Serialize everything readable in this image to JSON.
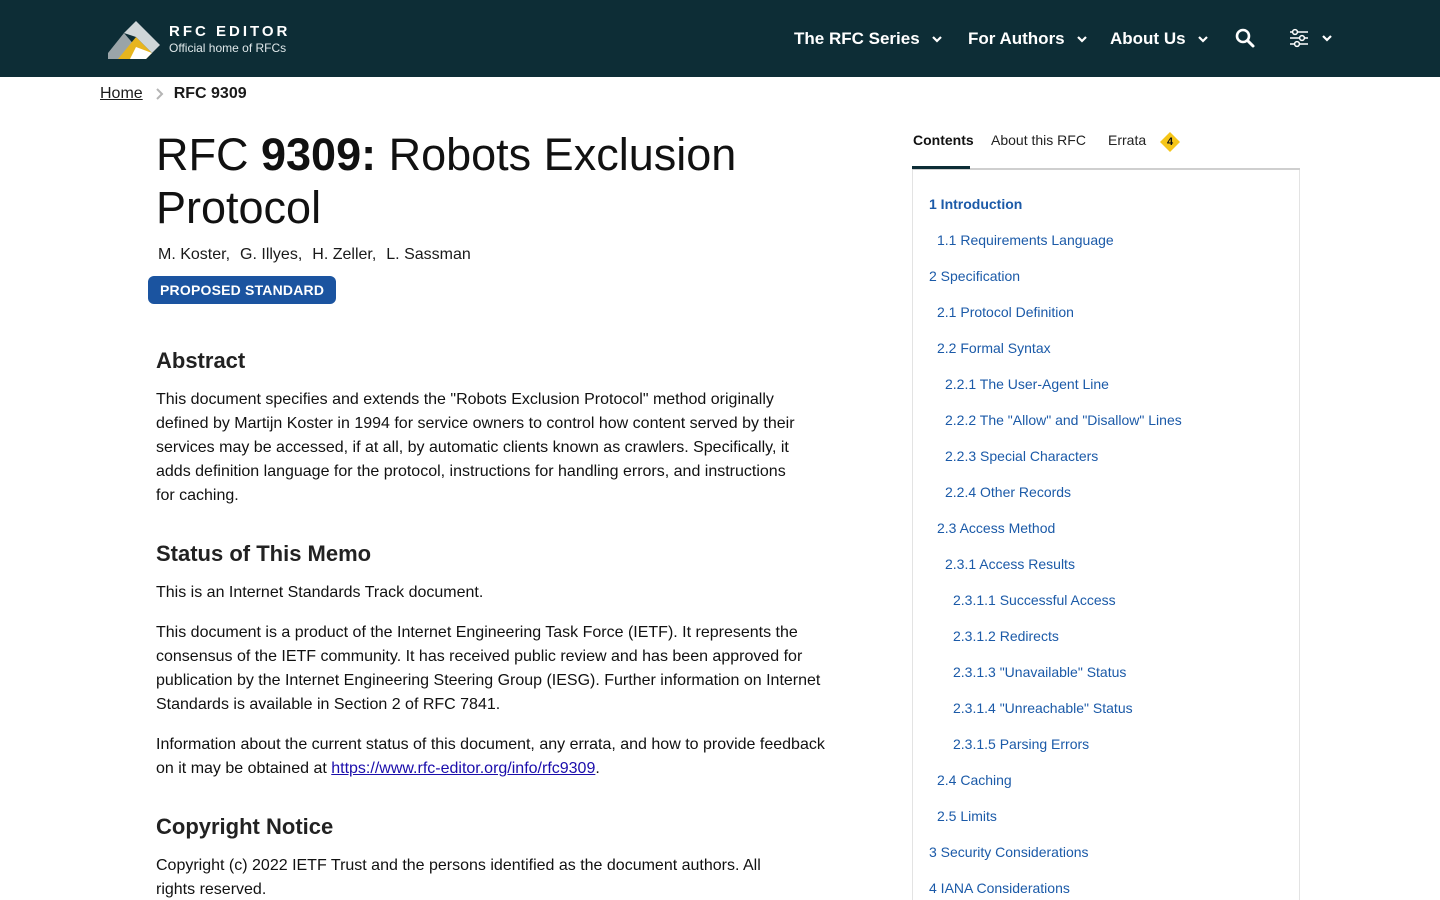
{
  "header": {
    "logo_title": "RFC EDITOR",
    "logo_subtitle": "Official home of RFCs",
    "nav": {
      "series": "The RFC Series",
      "authors": "For Authors",
      "about": "About Us"
    }
  },
  "breadcrumb": {
    "home": "Home",
    "current": "RFC 9309"
  },
  "document": {
    "title_prefix": "RFC ",
    "title_number": "9309:",
    "title_text": " Robots Exclusion Protocol",
    "authors": [
      "M. Koster,",
      "G. Illyes,",
      "H. Zeller,",
      "L. Sassman"
    ],
    "status_badge": "PROPOSED STANDARD",
    "abstract_heading": "Abstract",
    "abstract_text": "This document specifies and extends the \"Robots Exclusion Protocol\" method originally defined by Martijn Koster in 1994 for service owners to control how content served by their services may be accessed, if at all, by automatic clients known as crawlers. Specifically, it adds definition language for the protocol, instructions for handling errors, and instructions for caching.",
    "status_heading": "Status of This Memo",
    "status_p1": "This is an Internet Standards Track document.",
    "status_p2": "This document is a product of the Internet Engineering Task Force (IETF). It represents the consensus of the IETF community. It has received public review and has been approved for publication by the Internet Engineering Steering Group (IESG). Further information on Internet Standards is available in Section 2 of RFC 7841.",
    "status_p3_before": "Information about the current status of this document, any errata, and how to provide feedback on it may be obtained at ",
    "status_p3_link": "https://www.rfc-editor.org/info/rfc9309",
    "status_p3_after": ".",
    "copyright_heading": "Copyright Notice",
    "copyright_text": "Copyright (c) 2022 IETF Trust and the persons identified as the document authors. All rights reserved."
  },
  "sidebar": {
    "tabs": {
      "contents": "Contents",
      "about": "About this RFC",
      "errata": "Errata",
      "errata_count": "4"
    },
    "toc": [
      "1 Introduction",
      "1.1 Requirements Language",
      "2 Specification",
      "2.1 Protocol Definition",
      "2.2 Formal Syntax",
      "2.2.1 The User-Agent Line",
      "2.2.2 The \"Allow\" and \"Disallow\" Lines",
      "2.2.3 Special Characters",
      "2.2.4 Other Records",
      "2.3 Access Method",
      "2.3.1 Access Results",
      "2.3.1.1 Successful Access",
      "2.3.1.2 Redirects",
      "2.3.1.3 \"Unavailable\" Status",
      "2.3.1.4 \"Unreachable\" Status",
      "2.3.1.5 Parsing Errors",
      "2.4 Caching",
      "2.5 Limits",
      "3 Security Considerations",
      "4 IANA Considerations"
    ]
  },
  "colors": {
    "header_bg": "#0d2d36",
    "badge_blue": "#1b54a0",
    "toc_link": "#1b5aa8",
    "errata_yellow": "#f5c518"
  }
}
